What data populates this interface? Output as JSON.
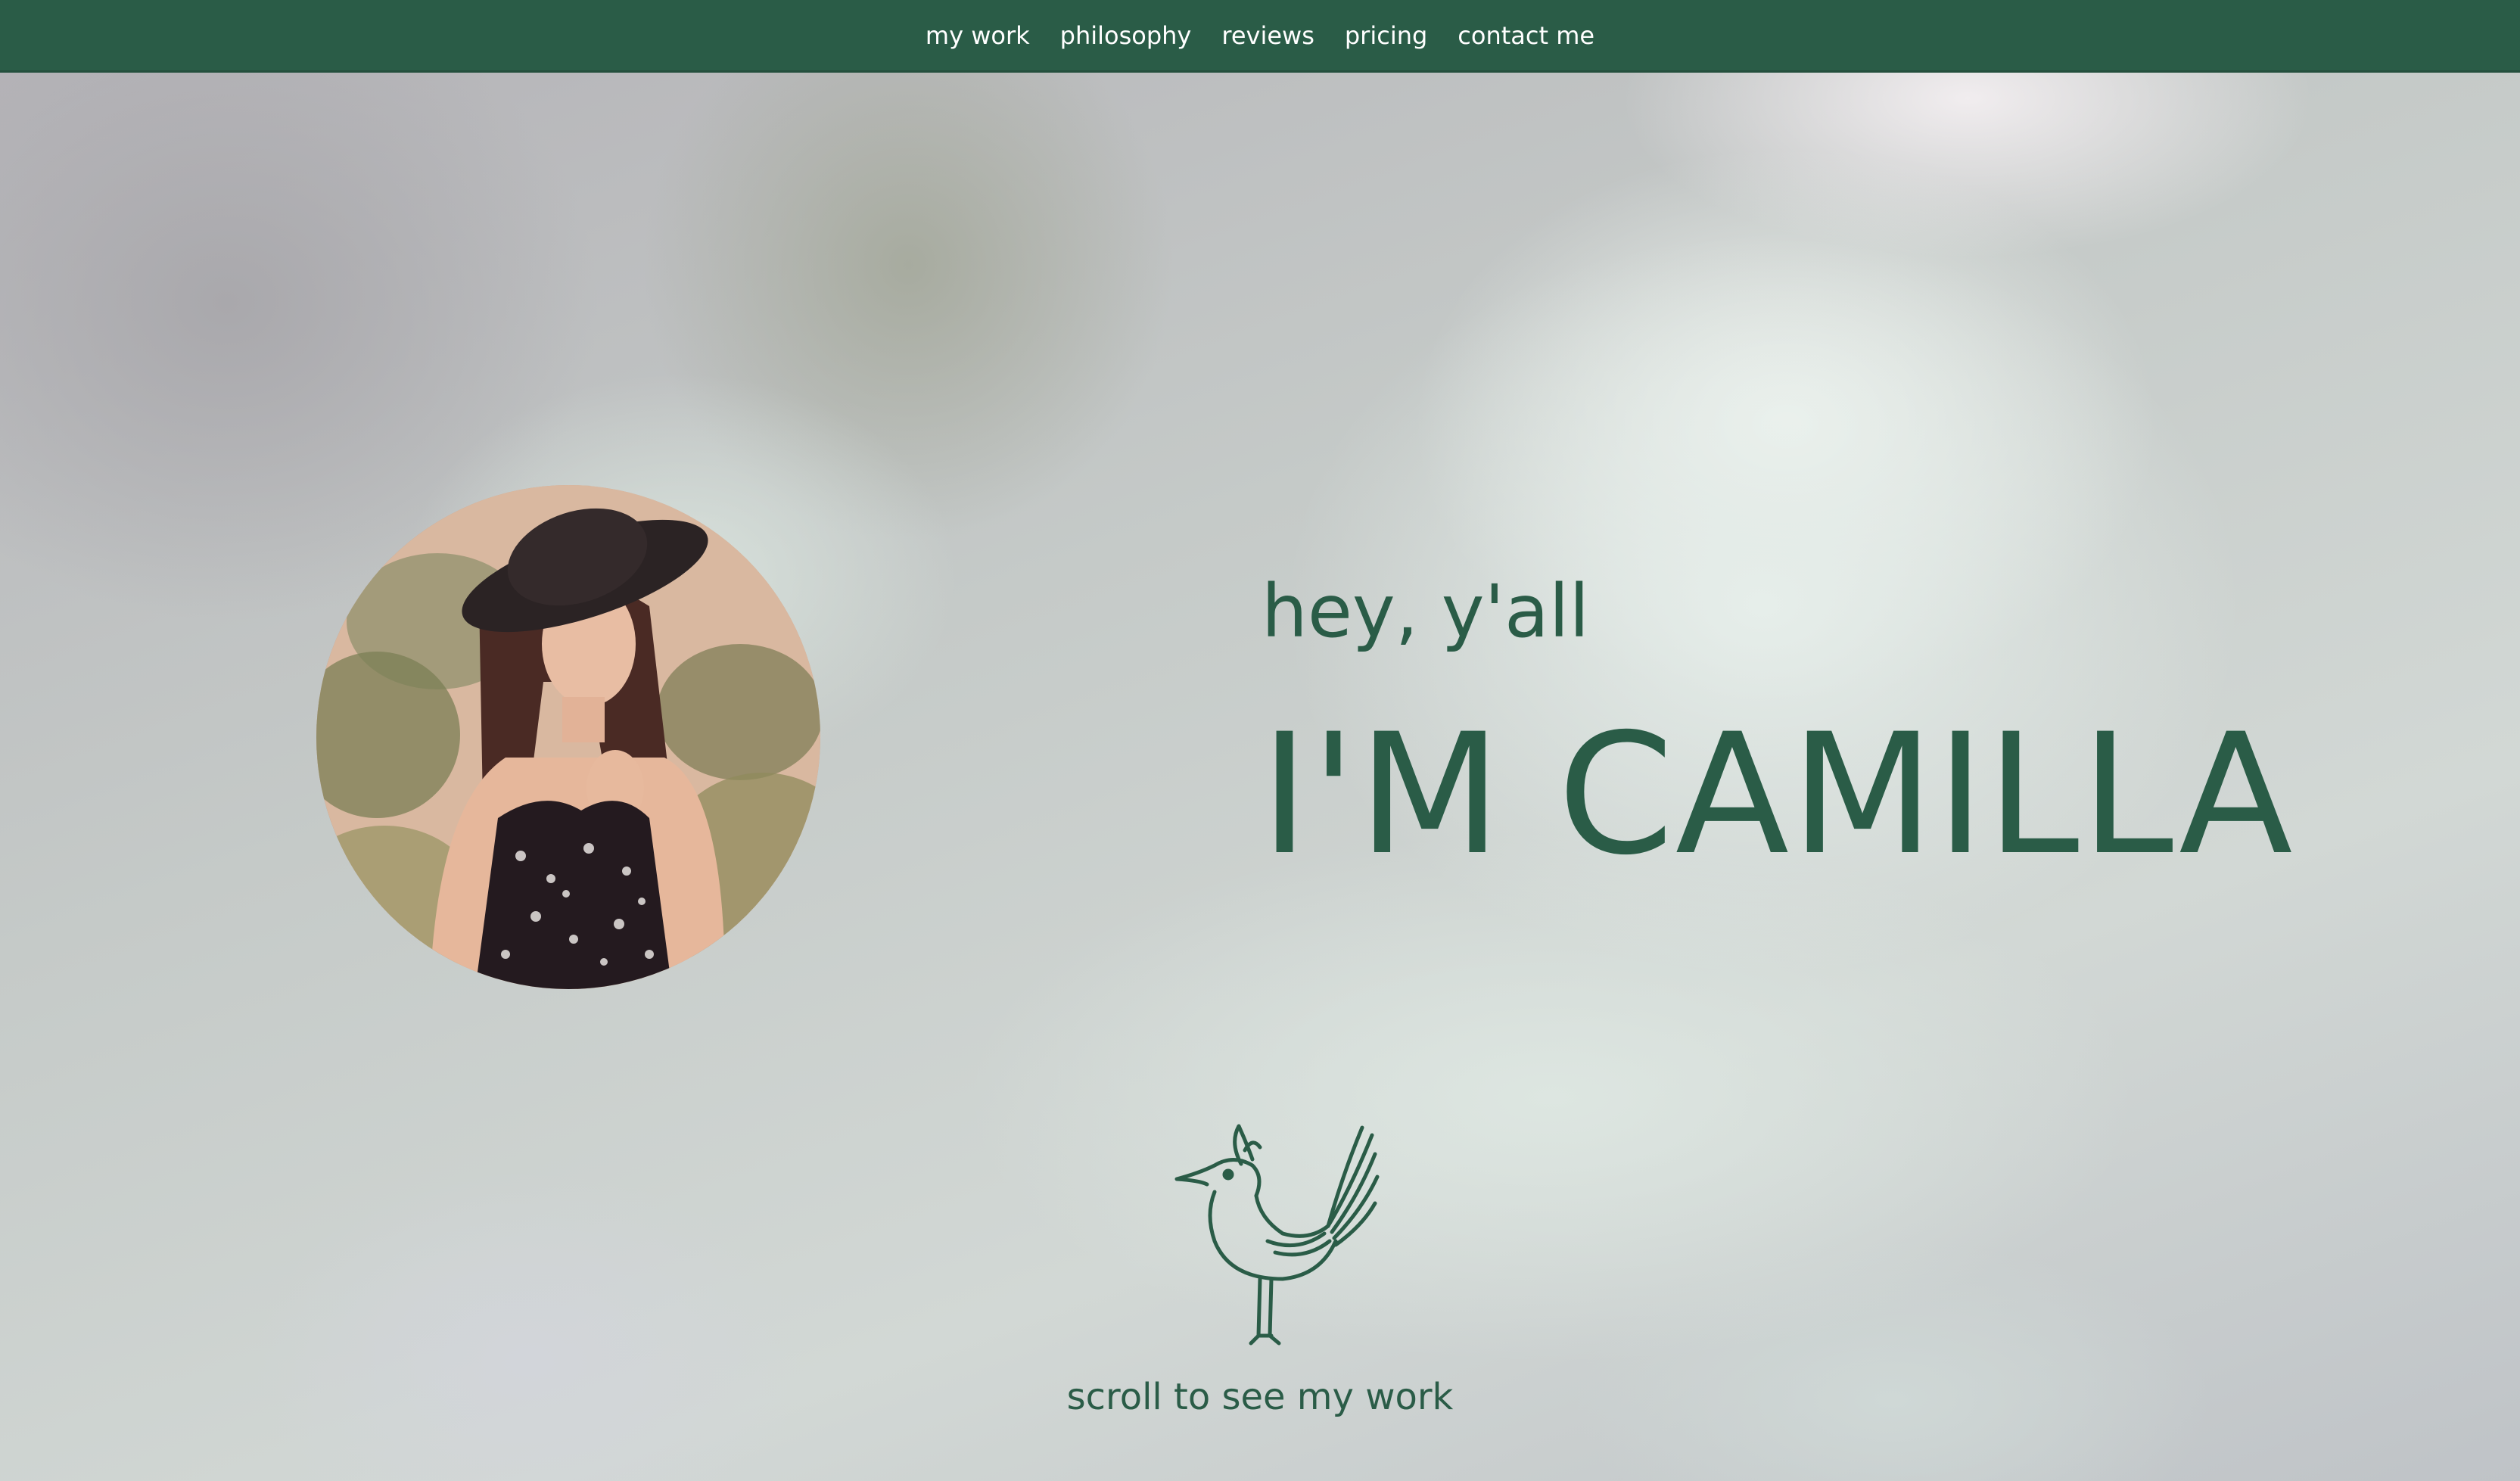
{
  "nav": {
    "items": [
      {
        "label": "my work"
      },
      {
        "label": "philosophy"
      },
      {
        "label": "reviews"
      },
      {
        "label": "pricing"
      },
      {
        "label": "contact me"
      }
    ]
  },
  "hero": {
    "greeting": "hey, y'all",
    "title": "I'M CAMILLA",
    "scroll_label": "scroll to see my work"
  },
  "icons": {
    "bird": "bird-icon"
  },
  "colors": {
    "brand_green": "#2a5c47",
    "nav_text": "#ffffff"
  }
}
